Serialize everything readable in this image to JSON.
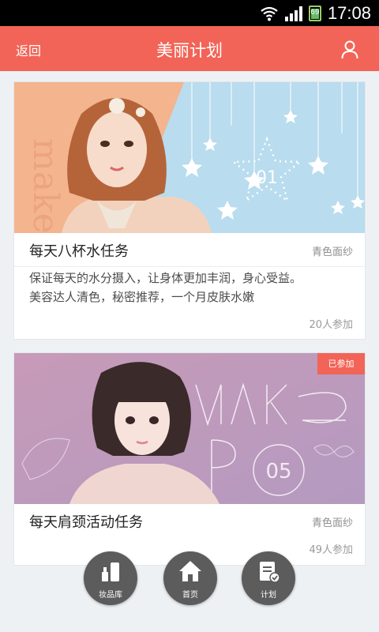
{
  "status_bar": {
    "time": "17:08",
    "battery": "69"
  },
  "header": {
    "back_label": "返回",
    "title": "美丽计划"
  },
  "plans": [
    {
      "title": "每天八杯水任务",
      "tag": "青色面纱",
      "description_lines": [
        "保证每天的水分摄入，让身体更加丰润，身心受益。",
        "美容达人清色，秘密推荐，一个月皮肤水嫩"
      ],
      "participants": "20人参加",
      "banner_number": "01"
    },
    {
      "title": "每天肩颈活动任务",
      "tag": "青色面纱",
      "participants": "49人参加",
      "badge": "已参加",
      "banner_number": "05"
    }
  ],
  "bottom_nav": [
    {
      "label": "妆品库",
      "icon": "cosmetics-icon"
    },
    {
      "label": "首页",
      "icon": "home-icon"
    },
    {
      "label": "计划",
      "icon": "plan-icon"
    }
  ],
  "colors": {
    "accent": "#f26457",
    "fab": "#5c5c5c"
  }
}
